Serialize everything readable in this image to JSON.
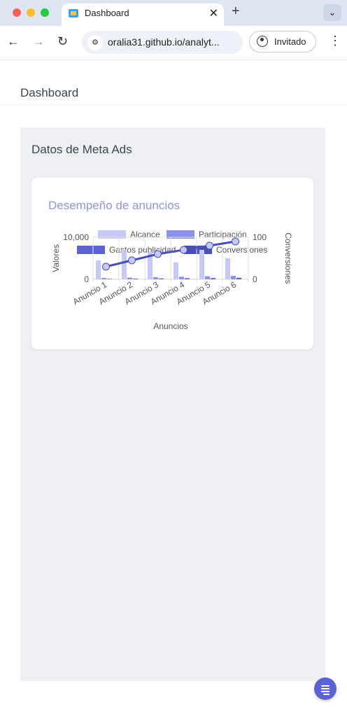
{
  "browser": {
    "tab_title": "Dashboard",
    "url": "oralia31.github.io/analyt...",
    "guest_label": "Invitado"
  },
  "page": {
    "header_title": "Dashboard",
    "section_title": "Datos de Meta Ads",
    "card_title": "Desempeño de anuncios"
  },
  "chart_data": {
    "type": "bar",
    "title": "",
    "categories": [
      "Anuncio 1",
      "Anuncio 2",
      "Anuncio 3",
      "Anuncio 4",
      "Anuncio 5",
      "Anuncio 6"
    ],
    "xlabel": "Anuncios",
    "ylabel": "Valores",
    "y2label": "Conversiones",
    "ylim": [
      0,
      10000
    ],
    "y_ticks": [
      "10,000",
      "0"
    ],
    "y2lim": [
      0,
      100
    ],
    "y2_ticks": [
      "100",
      "0"
    ],
    "legend": [
      "Alcance",
      "Participación",
      "Gastos publicidad",
      "Conversiones"
    ],
    "legend_position": "top",
    "series": [
      {
        "name": "Alcance",
        "type": "bar",
        "axis": "left",
        "color": "#c4c9f8",
        "values": [
          4500,
          7000,
          6500,
          4000,
          7000,
          5000
        ]
      },
      {
        "name": "Participación",
        "type": "bar",
        "axis": "left",
        "color": "#8a90ec",
        "values": [
          300,
          400,
          500,
          600,
          700,
          800
        ]
      },
      {
        "name": "Gastos publicidad",
        "type": "bar",
        "axis": "left",
        "color": "#5b63d3",
        "values": [
          100,
          150,
          200,
          250,
          300,
          350
        ]
      },
      {
        "name": "Conversiones",
        "type": "line",
        "axis": "right",
        "color": "#4a4fb8",
        "values": [
          30,
          45,
          60,
          70,
          80,
          90
        ]
      }
    ]
  }
}
